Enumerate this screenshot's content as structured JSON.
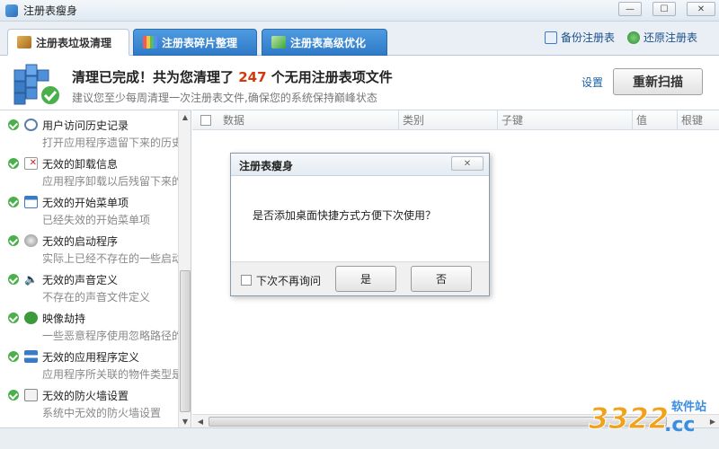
{
  "window": {
    "title": "注册表瘦身",
    "controls": {
      "minimize": "—",
      "maximize": "☐",
      "close": "✕"
    }
  },
  "tabs": [
    {
      "label": "注册表垃圾清理",
      "icon": "broom-icon",
      "active": true
    },
    {
      "label": "注册表碎片整理",
      "icon": "defrag-blocks-icon",
      "active": false
    },
    {
      "label": "注册表高级优化",
      "icon": "chart-icon",
      "active": false
    }
  ],
  "toolbar": {
    "backup_label": "备份注册表",
    "restore_label": "还原注册表"
  },
  "status": {
    "main_prefix": "清理已完成！共为您清理了",
    "count": "247",
    "main_suffix": "个无用注册表项文件",
    "sub": "建议您至少每周清理一次注册表文件,确保您的系统保持巅峰状态",
    "settings_label": "设置",
    "rescan_label": "重新扫描"
  },
  "categories": [
    {
      "title": "用户访问历史记录",
      "desc": "打开应用程序遗留下来的历史",
      "icon": "clock-icon"
    },
    {
      "title": "无效的卸载信息",
      "desc": "应用程序卸载以后残留下来的",
      "icon": "uninstall-icon"
    },
    {
      "title": "无效的开始菜单项",
      "desc": "已经失效的开始菜单项",
      "icon": "start-menu-icon"
    },
    {
      "title": "无效的启动程序",
      "desc": "实际上已经不存在的一些启动",
      "icon": "startup-icon"
    },
    {
      "title": "无效的声音定义",
      "desc": "不存在的声音文件定义",
      "icon": "speaker-icon"
    },
    {
      "title": "映像劫持",
      "desc": "一些恶意程序使用忽略路径的",
      "icon": "bug-icon"
    },
    {
      "title": "无效的应用程序定义",
      "desc": "应用程序所关联的物件类型是",
      "icon": "network-icon"
    },
    {
      "title": "无效的防火墙设置",
      "desc": "系统中无效的防火墙设置",
      "icon": "firewall-icon"
    }
  ],
  "table": {
    "columns": [
      "数据",
      "类别",
      "子键",
      "值",
      "根键"
    ]
  },
  "dialog": {
    "title": "注册表瘦身",
    "close": "✕",
    "message": "是否添加桌面快捷方式方便下次使用？",
    "checkbox_label": "下次不再询问",
    "yes_label": "是",
    "no_label": "否"
  },
  "watermark": {
    "number": "3322",
    "site": "软件站",
    "tld": ".cc"
  },
  "colors": {
    "accent": "#2e7ac8",
    "count": "#d4380d",
    "success": "#4bb04b"
  }
}
